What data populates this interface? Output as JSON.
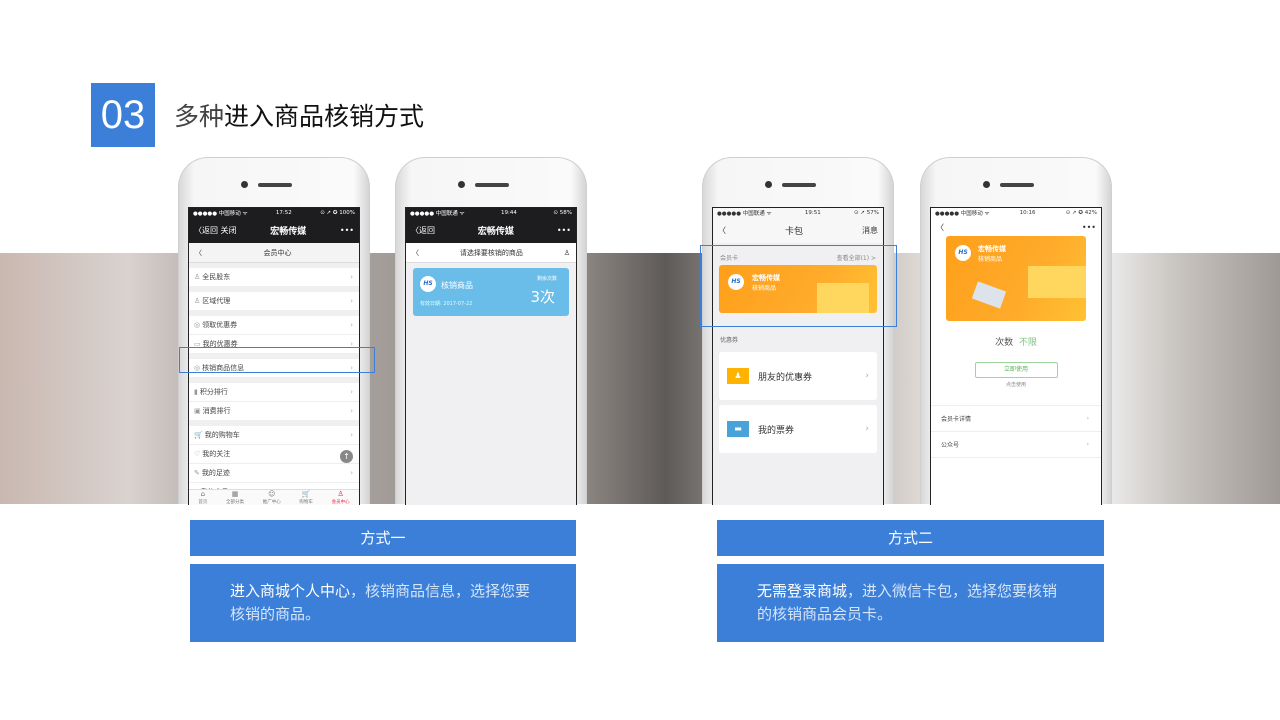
{
  "slide": {
    "number": "03",
    "title_light": "多种",
    "title_bold": "进入商品核销方式"
  },
  "phone1": {
    "status": {
      "carrier": "●●●●● 中国移动 ᯤ",
      "time": "17:52",
      "battery": "⊙ ➚ ✪ 100%"
    },
    "back": "〈返回",
    "close": "关闭",
    "title": "宏畅传媒",
    "more": "•••",
    "subtitle": "会员中心",
    "rows": [
      [
        "全民股东",
        "♙"
      ],
      [
        "区域代理",
        "♙"
      ],
      [
        "领取优惠券",
        "◎"
      ],
      [
        "我的优惠券",
        "▭"
      ],
      [
        "核销商品信息",
        "◎"
      ],
      [
        "积分排行",
        "▮"
      ],
      [
        "消费排行",
        "▣"
      ],
      [
        "我的购物车",
        "🛒"
      ],
      [
        "我的关注",
        "♡"
      ],
      [
        "我的足迹",
        "✎"
      ],
      [
        "我的会员",
        "⌂"
      ]
    ],
    "tabs": [
      "首页",
      "全部分类",
      "推广中心",
      "购物车",
      "会员中心"
    ]
  },
  "phone2": {
    "status": {
      "carrier": "●●●●● 中国联通 ᯤ",
      "time": "19:44",
      "battery": "⊙ 58%"
    },
    "back": "〈返回",
    "title": "宏畅传媒",
    "more": "•••",
    "subtitle": "请选择要核销的商品",
    "card": {
      "logo": "HS",
      "name": "核销商品",
      "remaining_label": "剩余次数",
      "remaining": "3次",
      "expiry": "有效日期:  2017-07-22"
    }
  },
  "phone3": {
    "status": {
      "carrier": "●●●●● 中国联通 ᯤ",
      "time": "19:51",
      "battery": "⊙ ➚ 57%"
    },
    "title": "卡包",
    "messages": "消息",
    "member_label": "会员卡",
    "view_all": "查看全部(1) >",
    "card": {
      "logo": "HS",
      "brand": "宏畅传媒",
      "name": "核销商品"
    },
    "coupon_label": "优惠券",
    "coupons": [
      "朋友的优惠券",
      "我的票券"
    ]
  },
  "phone4": {
    "status": {
      "carrier": "●●●●● 中国移动 ᯤ",
      "time": "10:16",
      "battery": "⊙ ➚ ✪ 42%"
    },
    "more": "•••",
    "card": {
      "logo": "HS",
      "brand": "宏畅传媒",
      "name": "核销商品"
    },
    "count_label": "次数",
    "count_value": "不限",
    "use_button": "立即使用",
    "use_hint": "点击使用",
    "rows": [
      "会员卡详情",
      "公众号"
    ]
  },
  "method1": {
    "label": "方式一",
    "desc_bold": "进入商城个人中心",
    "desc": "，核销商品信息，选择您要核销的商品。"
  },
  "method2": {
    "label": "方式二",
    "desc_bold": "无需登录商城",
    "desc": "，进入微信卡包，选择您要核销的核销商品会员卡。"
  },
  "colors": {
    "accent": "#3b7fd9",
    "card_orange": "#ffa21f",
    "card_blue": "#6bbde9",
    "green": "#7cc47c"
  }
}
